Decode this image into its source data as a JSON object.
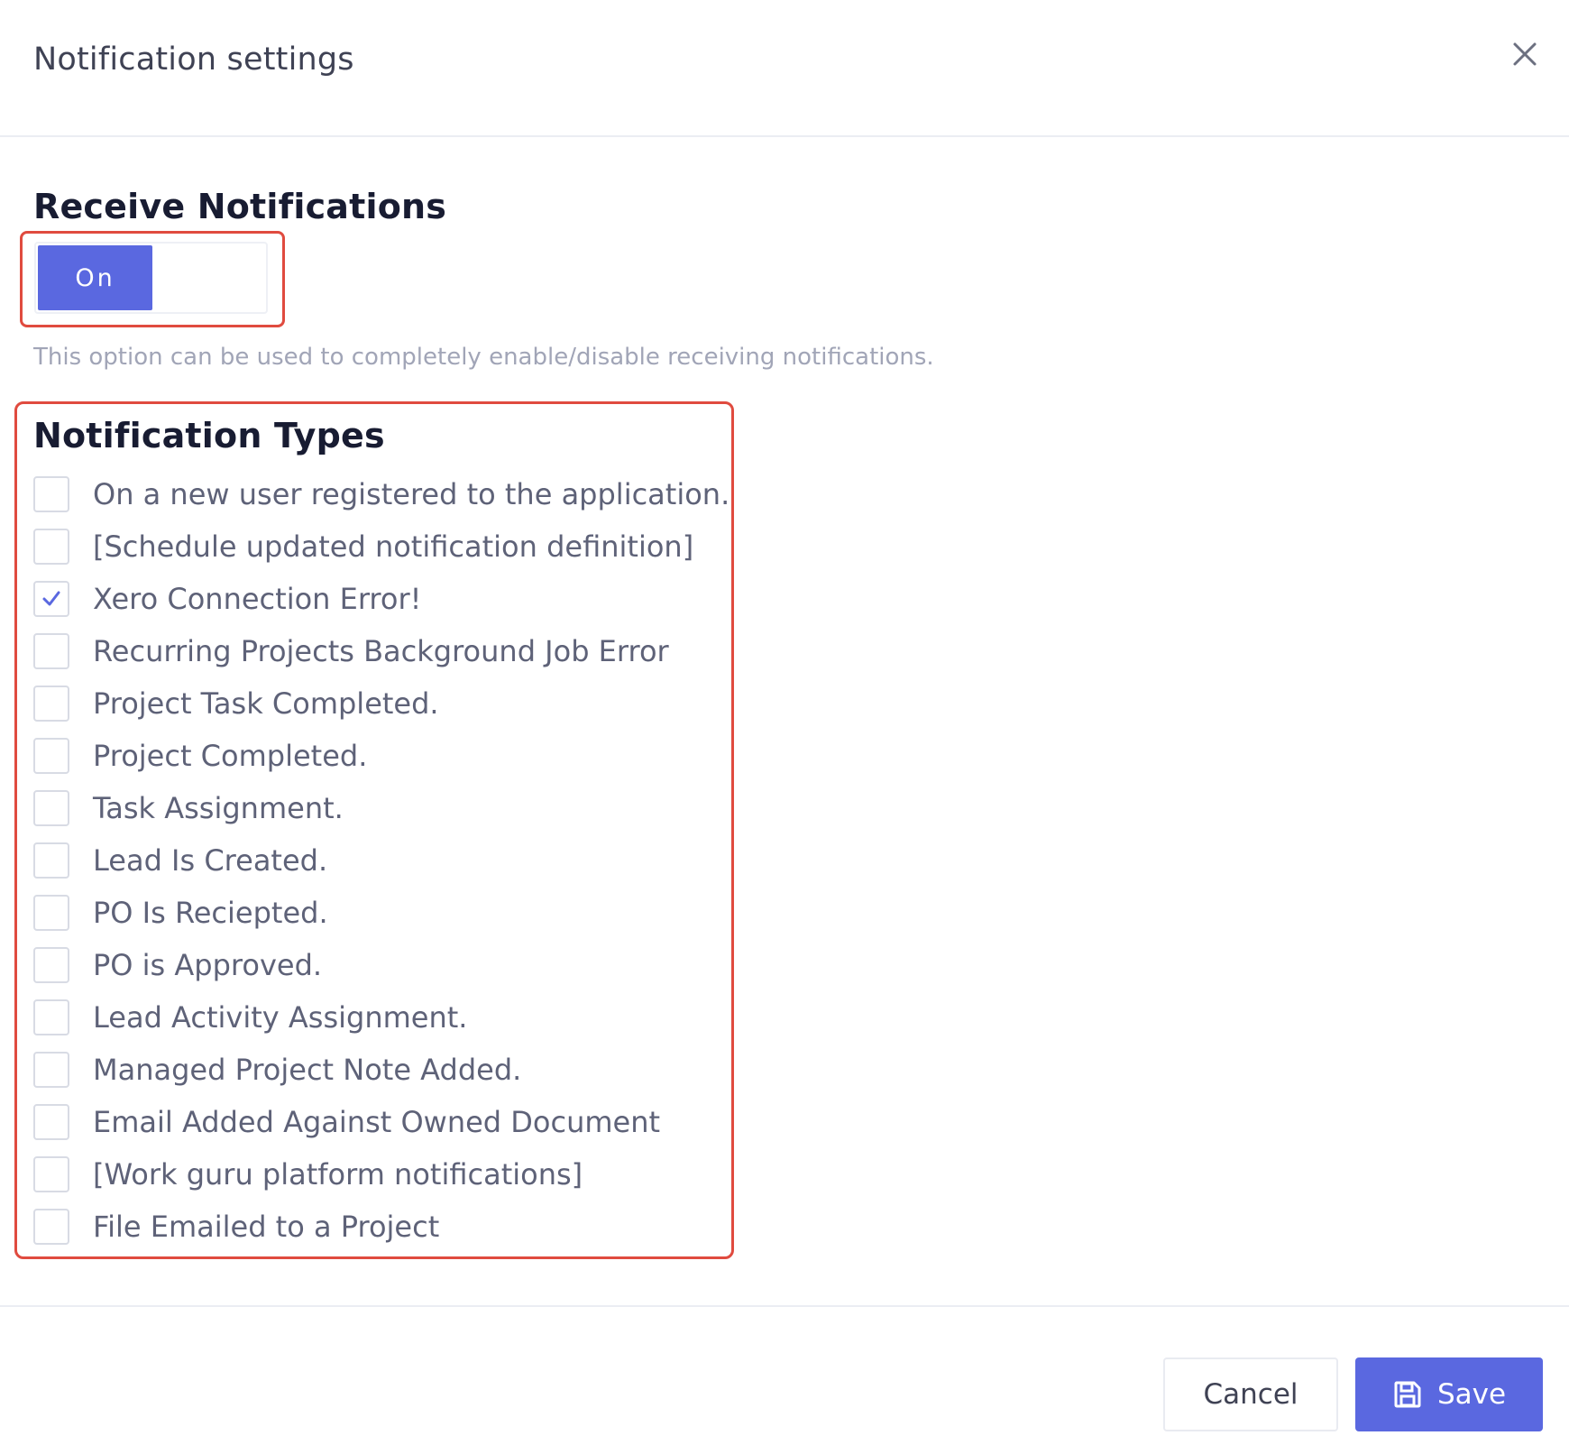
{
  "dialog": {
    "title": "Notification settings"
  },
  "receive": {
    "heading": "Receive Notifications",
    "toggle_label": "On",
    "toggle_state": "on",
    "help_text": "This option can be used to completely enable/disable receiving notifications."
  },
  "types": {
    "heading": "Notification Types",
    "items": [
      {
        "label": "On a new user registered to the application.",
        "checked": false
      },
      {
        "label": "[Schedule updated notification definition]",
        "checked": false
      },
      {
        "label": "Xero Connection Error!",
        "checked": true
      },
      {
        "label": "Recurring Projects Background Job Error",
        "checked": false
      },
      {
        "label": "Project Task Completed.",
        "checked": false
      },
      {
        "label": "Project Completed.",
        "checked": false
      },
      {
        "label": "Task Assignment.",
        "checked": false
      },
      {
        "label": "Lead Is Created.",
        "checked": false
      },
      {
        "label": "PO Is Reciepted.",
        "checked": false
      },
      {
        "label": "PO is Approved.",
        "checked": false
      },
      {
        "label": "Lead Activity Assignment.",
        "checked": false
      },
      {
        "label": "Managed Project Note Added.",
        "checked": false
      },
      {
        "label": "Email Added Against Owned Document",
        "checked": false
      },
      {
        "label": "[Work guru platform notifications]",
        "checked": false
      },
      {
        "label": "File Emailed to a Project",
        "checked": false
      }
    ]
  },
  "footer": {
    "cancel_label": "Cancel",
    "save_label": "Save"
  },
  "colors": {
    "accent": "#5a68e0",
    "highlight": "#e04b3f"
  },
  "icons": {
    "close": "close-icon",
    "check": "check-icon",
    "save": "floppy-disk-icon"
  }
}
